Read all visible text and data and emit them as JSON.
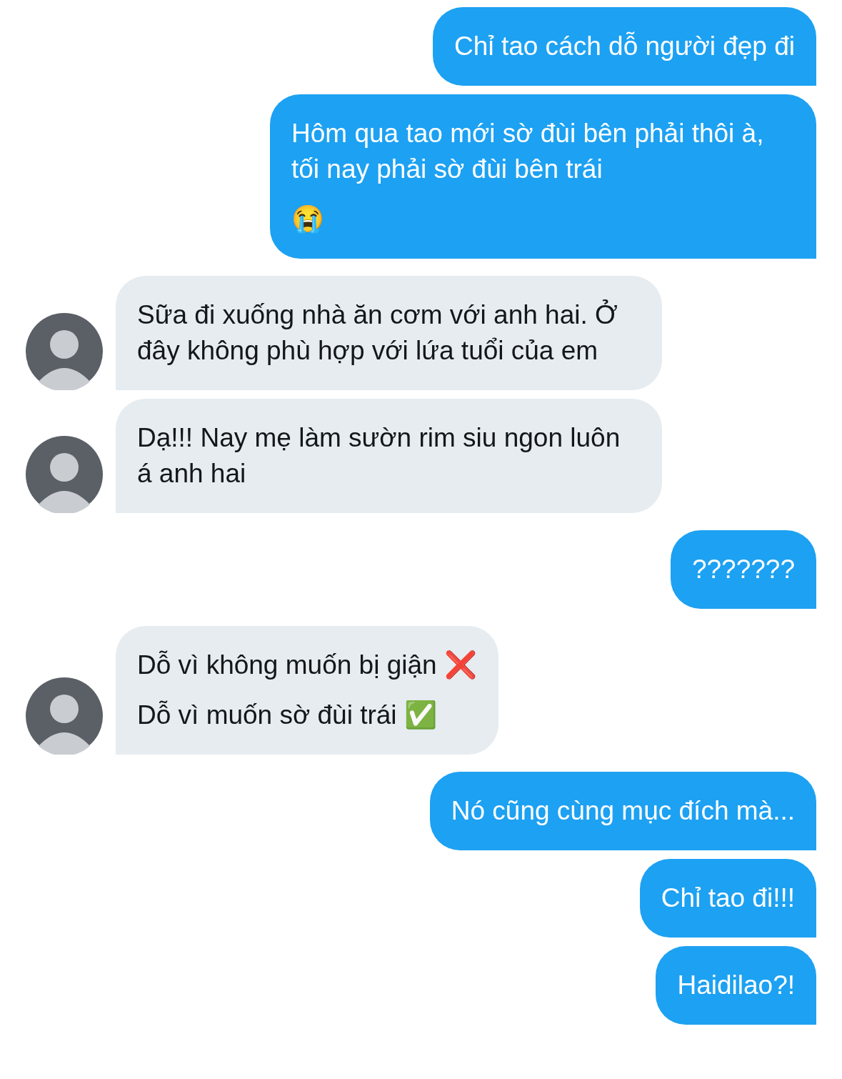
{
  "messages": [
    {
      "kind": "outgoing",
      "paragraphs": [
        "Chỉ tao cách dỗ người đẹp đi"
      ]
    },
    {
      "kind": "outgoing",
      "paragraphs": [
        "Hôm qua tao mới sờ đùi bên phải thôi à, tối nay phải sờ đùi bên trái",
        "😭"
      ]
    },
    {
      "kind": "incoming",
      "paragraphs": [
        "Sữa đi xuống nhà ăn cơm với anh hai. Ở đây không phù hợp với lứa tuổi của em"
      ]
    },
    {
      "kind": "incoming",
      "paragraphs": [
        "Dạ!!! Nay mẹ làm sườn rim siu ngon luôn á anh hai"
      ]
    },
    {
      "kind": "outgoing",
      "paragraphs": [
        "???????"
      ]
    },
    {
      "kind": "incoming",
      "paragraphs": [
        "Dỗ vì không muốn bị giận ❌",
        "Dỗ vì muốn sờ đùi trái ✅"
      ]
    },
    {
      "kind": "outgoing",
      "paragraphs": [
        "Nó cũng cùng mục đích mà..."
      ]
    },
    {
      "kind": "outgoing",
      "paragraphs": [
        "Chỉ tao đi!!!"
      ]
    },
    {
      "kind": "outgoing",
      "paragraphs": [
        "Haidilao?!"
      ]
    }
  ]
}
